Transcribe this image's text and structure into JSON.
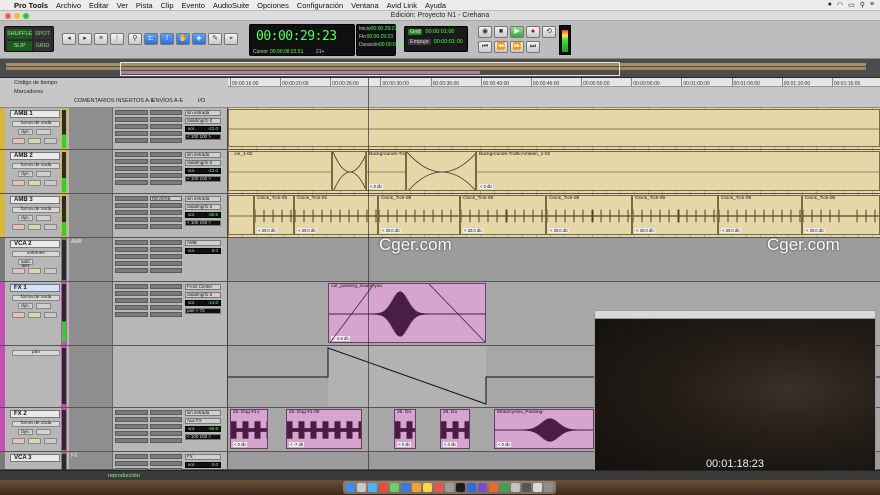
{
  "menubar": {
    "apple": "",
    "items": [
      "Pro Tools",
      "Archivo",
      "Editar",
      "Ver",
      "Pista",
      "Clip",
      "Evento",
      "AudioSuite",
      "Opciones",
      "Configuración",
      "Ventana",
      "Avid Link",
      "Ayuda"
    ]
  },
  "window": {
    "title": "Edición: Proyecto N1 - Crehana"
  },
  "toolbar": {
    "modes": [
      "SHUFFLE",
      "SPOT",
      "SLIP",
      "GRID"
    ],
    "counter_main": "00:00:29:23",
    "counter_cursor_label": "Cursor",
    "counter_cursor_value": "00:00:08:22.51",
    "counter_extra": "21+",
    "selection": {
      "start_label": "Inicio",
      "start": "00:00:29:23",
      "end_label": "Fin",
      "end": "00:00:29:23",
      "len_label": "Duración",
      "len": "00:00:00:00"
    },
    "grid": {
      "grid_label": "Grid",
      "grid_value": "00:00:01:00",
      "nudge_label": "Empuje",
      "nudge_value": "00:00:01:00"
    }
  },
  "mix_header": {
    "timecode_label": "Código de tiempo",
    "markers_label": "Marcadores",
    "columns": [
      "COMENTARIOS",
      "INSERTOS A-E",
      "ENVÍOS A-E",
      "I/O"
    ]
  },
  "ruler": {
    "ticks": [
      "00:00:16:00",
      "00:00:20:00",
      "00:00:26:00",
      "00:00:30:00",
      "00:00:36:00",
      "00:00:40:00",
      "00:00:46:00",
      "00:00:50:00",
      "00:00:56:00",
      "00:01:00:00",
      "00:01:06:00",
      "00:01:10:00",
      "00:01:16:00"
    ]
  },
  "tracks": [
    {
      "name": "AMB 1",
      "mode": "forma de onda",
      "dyn": "dyn.",
      "io_in": "sin entrada",
      "io_out": "Salidmgrl1-2",
      "vol_label": "vol.",
      "vol": "-21.0",
      "pan": "< 100   100 >",
      "send": ""
    },
    {
      "name": "AMB 2",
      "mode": "forma de onda",
      "dyn": "dyn.",
      "io_in": "sin entrada",
      "io_out": "Salidmgrl1-2",
      "vol_label": "vol.",
      "vol": "-13.0",
      "pan": "< 100   100 >",
      "send": ""
    },
    {
      "name": "AMB 3",
      "mode": "forma de onda",
      "dyn": "dyn.",
      "io_in": "sin entrada",
      "io_out": "Salidmgrl1-2",
      "vol_label": "vol.",
      "vol": "-30.6",
      "pan": "< 100   100 >",
      "send": "REVERB"
    },
    {
      "name": "VCA 2",
      "mode": "volumen",
      "dyn": "auto leer",
      "io_in": "AMB",
      "io_out": "",
      "vol_label": "vol.",
      "vol": "0.0",
      "pan": "",
      "send": "",
      "comment": "AMB"
    },
    {
      "name": "FX 1",
      "mode": "forma de onda",
      "dyn": "dyn.",
      "io_in": "Front Center",
      "io_out": "Salidmgrl1-2",
      "vol_label": "vol.",
      "vol": "-14.0",
      "pan": "pan  > 72",
      "send": ""
    },
    {
      "name": "",
      "mode": "pan",
      "dyn": "",
      "io_in": "",
      "io_out": "",
      "vol_label": "",
      "vol": "",
      "pan": "",
      "send": ""
    },
    {
      "name": "FX 2",
      "mode": "forma de onda",
      "dyn": "dyn.",
      "io_in": "sin entrada",
      "io_out": "Aux FX",
      "vol_label": "vol.",
      "vol": "-36.6",
      "pan": "< 100   100 >",
      "send": ""
    },
    {
      "name": "VCA 3",
      "mode": "",
      "dyn": "",
      "io_in": "FX",
      "io_out": "",
      "vol_label": "vol.",
      "vol": "0.0",
      "pan": "",
      "send": "",
      "comment": "FX"
    }
  ],
  "clips": {
    "amb2": [
      {
        "name": "...nn_1-02",
        "vol": ""
      },
      {
        "name": "",
        "vol": ""
      },
      {
        "name": "Backgrounds-Traff",
        "vol": "< 0 db"
      },
      {
        "name": "",
        "vol": ""
      },
      {
        "name": "Backgrounds-TrafficAmbien_1-02",
        "vol": "< 0 db"
      }
    ],
    "amb3": [
      {
        "name": "Clock_Tick-05",
        "vol": "< 30.0 db"
      },
      {
        "name": "Clock_Tick-01",
        "vol": "< 30.0 db"
      },
      {
        "name": "Clock_Tick-08",
        "vol": "< 30.0 db"
      },
      {
        "name": "Clock_Tick-06",
        "vol": "< 30.0 db"
      },
      {
        "name": "Clock_Tick-08",
        "vol": "< 30.0 db"
      },
      {
        "name": "Clock_Tick-06",
        "vol": "< 30.0 db"
      },
      {
        "name": "Clock_Tick-08",
        "vol": "< 30.0 db"
      },
      {
        "name": "Clock_Tick-06",
        "vol": "< 30.0 db"
      }
    ],
    "fx1": {
      "name": "car_passing_sound-you",
      "vol": "< -2.6 db"
    },
    "fx2": [
      {
        "name": "26. Dog #1-(",
        "vol": "< 0 db"
      },
      {
        "name": "26. Dog #1-06",
        "vol": "< -7 db"
      },
      {
        "name": "26. Do",
        "vol": "< 0 db"
      },
      {
        "name": "26. Do",
        "vol": "< 0 db"
      },
      {
        "name": "Motorcycles_Passing-",
        "vol": "< 0 db"
      }
    ]
  },
  "watermarks": [
    "Cger.com",
    "Cger.com"
  ],
  "video": {
    "timecode": "00:01:18:23"
  },
  "status": {
    "text": "reproducción"
  },
  "colors": {
    "amb": "#e6d7a9",
    "fx": "#d7a3cf",
    "fx_border": "#9a5c8f",
    "counter_green": "#58ff58"
  }
}
